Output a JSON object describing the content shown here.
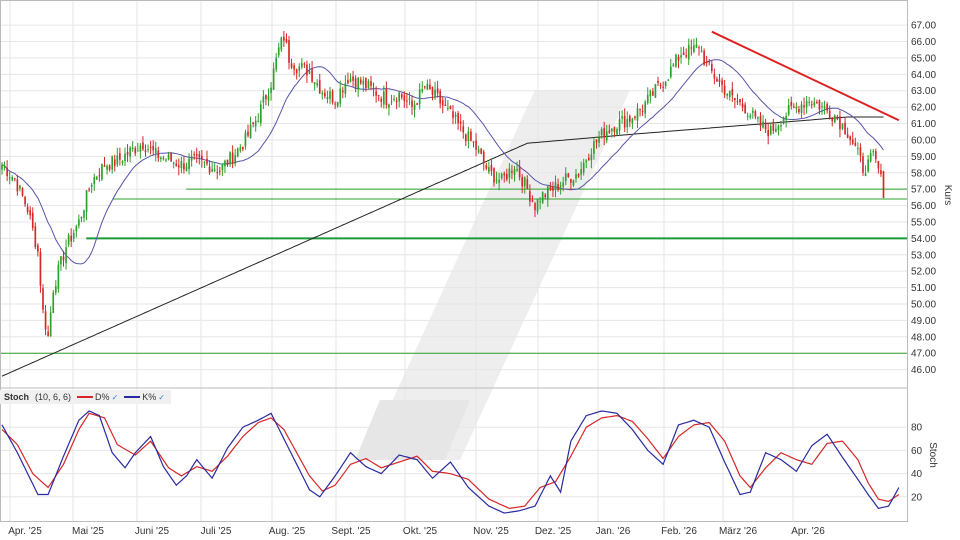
{
  "chart_data": [
    {
      "type": "candlestick",
      "panel": "price",
      "ylabel": "Kurs",
      "ylim": [
        45,
        67.8
      ],
      "yticks": [
        46,
        47,
        48,
        49,
        50,
        51,
        52,
        53,
        54,
        55,
        56,
        57,
        58,
        59,
        60,
        61,
        62,
        63,
        64,
        65,
        66,
        67
      ],
      "ytick_labels": [
        "46.00",
        "47.00",
        "48.00",
        "49.00",
        "50.00",
        "51.00",
        "52.00",
        "53.00",
        "54.00",
        "55.00",
        "56.00",
        "57.00",
        "58.00",
        "59.00",
        "60.00",
        "61.00",
        "62.00",
        "63.00",
        "64.00",
        "65.00",
        "66.00",
        "67.00"
      ],
      "x_months": [
        "Apr. '25",
        "Mai '25",
        "Juni '25",
        "Juli '25",
        "Aug. '25",
        "Sept. '25",
        "Okt. '25",
        "Nov. '25",
        "Dez. '25",
        "Jan. '26",
        "Feb. '26",
        "März '26",
        "Apr. '26"
      ],
      "close_anchors": [
        [
          0,
          58.5
        ],
        [
          5,
          57.6
        ],
        [
          10,
          55.8
        ],
        [
          14,
          53.2
        ],
        [
          16,
          49.5
        ],
        [
          18,
          48.0
        ],
        [
          20,
          51.0
        ],
        [
          25,
          53.5
        ],
        [
          30,
          55.0
        ],
        [
          35,
          57.5
        ],
        [
          40,
          58.5
        ],
        [
          45,
          58.7
        ],
        [
          50,
          59.3
        ],
        [
          55,
          59.8
        ],
        [
          60,
          59.1
        ],
        [
          65,
          58.8
        ],
        [
          70,
          58.5
        ],
        [
          75,
          58.7
        ],
        [
          80,
          58.5
        ],
        [
          85,
          58.2
        ],
        [
          90,
          59.0
        ],
        [
          95,
          60.0
        ],
        [
          100,
          61.5
        ],
        [
          105,
          63.5
        ],
        [
          108,
          65.5
        ],
        [
          110,
          66.3
        ],
        [
          112,
          65.0
        ],
        [
          115,
          64.5
        ],
        [
          120,
          64.2
        ],
        [
          125,
          63.0
        ],
        [
          130,
          62.5
        ],
        [
          135,
          63.8
        ],
        [
          140,
          63.5
        ],
        [
          145,
          63.0
        ],
        [
          150,
          62.5
        ],
        [
          155,
          62.8
        ],
        [
          160,
          62.0
        ],
        [
          165,
          63.2
        ],
        [
          170,
          62.5
        ],
        [
          175,
          61.5
        ],
        [
          180,
          60.5
        ],
        [
          185,
          59.5
        ],
        [
          190,
          58.0
        ],
        [
          195,
          57.5
        ],
        [
          200,
          58.5
        ],
        [
          205,
          57.0
        ],
        [
          208,
          56.0
        ],
        [
          210,
          56.5
        ],
        [
          215,
          57.0
        ],
        [
          220,
          57.6
        ],
        [
          225,
          58.0
        ],
        [
          230,
          59.5
        ],
        [
          235,
          60.5
        ],
        [
          240,
          61.0
        ],
        [
          245,
          61.3
        ],
        [
          250,
          62.0
        ],
        [
          255,
          63.0
        ],
        [
          260,
          64.0
        ],
        [
          265,
          65.3
        ],
        [
          270,
          65.5
        ],
        [
          272,
          65.8
        ],
        [
          275,
          64.5
        ],
        [
          280,
          63.5
        ],
        [
          285,
          62.5
        ],
        [
          290,
          62.0
        ],
        [
          295,
          61.0
        ],
        [
          300,
          60.5
        ],
        [
          305,
          61.5
        ],
        [
          310,
          62.0
        ],
        [
          315,
          62.5
        ],
        [
          320,
          62.0
        ],
        [
          325,
          61.5
        ],
        [
          330,
          60.5
        ],
        [
          333,
          59.5
        ],
        [
          336,
          58.3
        ],
        [
          338,
          58.5
        ],
        [
          340,
          59.0
        ],
        [
          342,
          58.2
        ],
        [
          344,
          56.9
        ]
      ],
      "n_candles": 345,
      "up_color": "#2ca02c",
      "down_color": "#d62728",
      "indicators": [
        {
          "type": "moving_average",
          "period": 20,
          "color": "#5555aa"
        },
        {
          "type": "moving_average",
          "period": 200,
          "color": "#222222"
        }
      ],
      "horizontal_lines": [
        {
          "y": 57.0,
          "color": "#2ca02c",
          "x_from_fraction": 0.205
        },
        {
          "y": 56.4,
          "color": "#2ca02c",
          "x_from_fraction": 0.125
        },
        {
          "y": 54.0,
          "color": "#1a9a3a",
          "x_from_fraction": 0.095
        },
        {
          "y": 47.0,
          "color": "#2ca02c",
          "x_from_fraction": 0.0
        }
      ],
      "trendline": {
        "color": "#e02020",
        "points": [
          [
            277,
            66.6
          ],
          [
            350,
            61.2
          ]
        ]
      },
      "grid": true
    },
    {
      "type": "line",
      "panel": "stochastic",
      "title": "Stoch",
      "params": "(10, 6, 6)",
      "ylabel": "Stoch",
      "ylim": [
        0,
        100
      ],
      "yticks": [
        20,
        40,
        60,
        80
      ],
      "ytick_labels": [
        "20",
        "40",
        "60",
        "80"
      ],
      "series": [
        {
          "name": "D%",
          "color": "#d62728",
          "anchors": [
            [
              0,
              78
            ],
            [
              6,
              65
            ],
            [
              12,
              40
            ],
            [
              18,
              28
            ],
            [
              24,
              48
            ],
            [
              30,
              78
            ],
            [
              34,
              92
            ],
            [
              40,
              88
            ],
            [
              45,
              65
            ],
            [
              52,
              56
            ],
            [
              58,
              68
            ],
            [
              65,
              45
            ],
            [
              70,
              38
            ],
            [
              76,
              46
            ],
            [
              82,
              42
            ],
            [
              88,
              55
            ],
            [
              94,
              72
            ],
            [
              100,
              84
            ],
            [
              105,
              88
            ],
            [
              110,
              78
            ],
            [
              115,
              58
            ],
            [
              120,
              38
            ],
            [
              125,
              25
            ],
            [
              130,
              30
            ],
            [
              136,
              48
            ],
            [
              142,
              53
            ],
            [
              148,
              45
            ],
            [
              155,
              50
            ],
            [
              162,
              55
            ],
            [
              168,
              42
            ],
            [
              175,
              40
            ],
            [
              182,
              35
            ],
            [
              190,
              18
            ],
            [
              198,
              10
            ],
            [
              204,
              12
            ],
            [
              210,
              28
            ],
            [
              216,
              33
            ],
            [
              222,
              55
            ],
            [
              228,
              80
            ],
            [
              234,
              88
            ],
            [
              240,
              90
            ],
            [
              246,
              85
            ],
            [
              252,
              70
            ],
            [
              258,
              53
            ],
            [
              264,
              72
            ],
            [
              270,
              82
            ],
            [
              276,
              84
            ],
            [
              282,
              68
            ],
            [
              288,
              38
            ],
            [
              292,
              28
            ],
            [
              298,
              45
            ],
            [
              304,
              58
            ],
            [
              310,
              52
            ],
            [
              316,
              48
            ],
            [
              322,
              66
            ],
            [
              328,
              68
            ],
            [
              334,
              52
            ],
            [
              338,
              32
            ],
            [
              342,
              18
            ],
            [
              346,
              16
            ],
            [
              350,
              22
            ]
          ]
        },
        {
          "name": "K%",
          "color": "#2a2aa0",
          "anchors": [
            [
              0,
              82
            ],
            [
              6,
              58
            ],
            [
              10,
              40
            ],
            [
              14,
              22
            ],
            [
              18,
              22
            ],
            [
              24,
              55
            ],
            [
              30,
              86
            ],
            [
              34,
              94
            ],
            [
              38,
              90
            ],
            [
              43,
              58
            ],
            [
              48,
              45
            ],
            [
              52,
              58
            ],
            [
              58,
              72
            ],
            [
              63,
              46
            ],
            [
              68,
              30
            ],
            [
              72,
              38
            ],
            [
              76,
              52
            ],
            [
              82,
              36
            ],
            [
              88,
              62
            ],
            [
              94,
              80
            ],
            [
              100,
              86
            ],
            [
              105,
              92
            ],
            [
              110,
              70
            ],
            [
              115,
              48
            ],
            [
              120,
              26
            ],
            [
              124,
              20
            ],
            [
              130,
              38
            ],
            [
              136,
              58
            ],
            [
              142,
              46
            ],
            [
              148,
              40
            ],
            [
              155,
              56
            ],
            [
              162,
              52
            ],
            [
              168,
              36
            ],
            [
              175,
              50
            ],
            [
              182,
              28
            ],
            [
              190,
              12
            ],
            [
              196,
              6
            ],
            [
              202,
              8
            ],
            [
              208,
              12
            ],
            [
              214,
              38
            ],
            [
              218,
              24
            ],
            [
              222,
              68
            ],
            [
              228,
              90
            ],
            [
              234,
              94
            ],
            [
              240,
              92
            ],
            [
              246,
              78
            ],
            [
              252,
              60
            ],
            [
              258,
              48
            ],
            [
              264,
              82
            ],
            [
              270,
              86
            ],
            [
              276,
              80
            ],
            [
              282,
              50
            ],
            [
              288,
              22
            ],
            [
              292,
              24
            ],
            [
              298,
              58
            ],
            [
              304,
              52
            ],
            [
              310,
              42
            ],
            [
              316,
              64
            ],
            [
              322,
              74
            ],
            [
              328,
              54
            ],
            [
              334,
              35
            ],
            [
              338,
              22
            ],
            [
              342,
              10
            ],
            [
              346,
              12
            ],
            [
              350,
              28
            ]
          ]
        }
      ],
      "legend": "top-left",
      "grid": true
    }
  ]
}
